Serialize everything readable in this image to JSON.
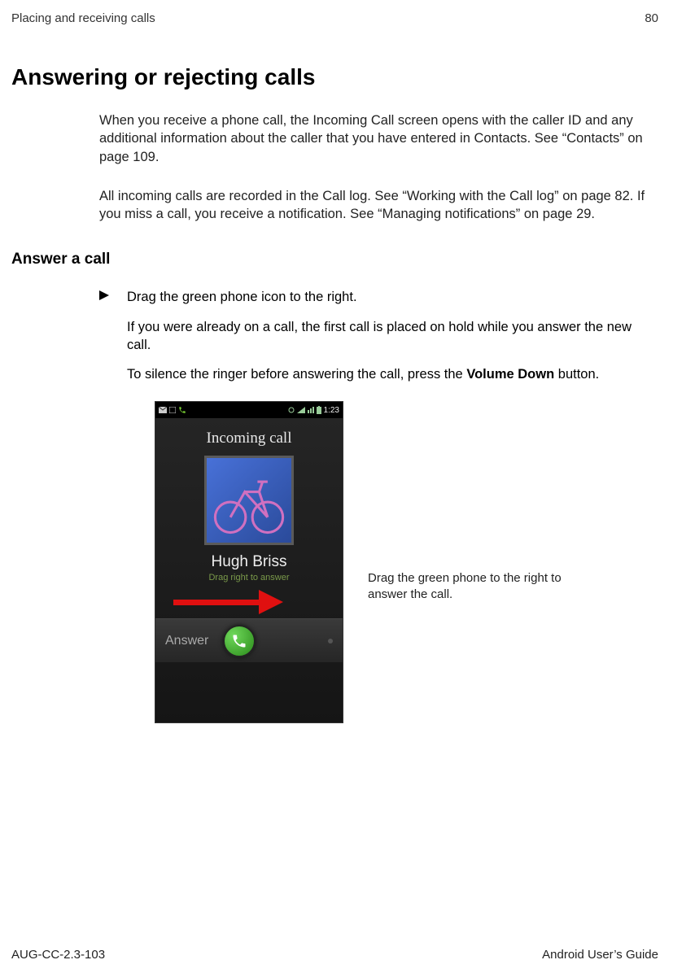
{
  "header": {
    "chapter": "Placing and receiving calls",
    "page_number": "80"
  },
  "title": "Answering or rejecting calls",
  "intro": [
    "When you receive a phone call, the Incoming Call screen opens with the caller ID and any additional information about the caller that you have entered in Contacts. See “Contacts” on page 109.",
    "All incoming calls are recorded in the Call log. See “Working with the Call log” on page 82. If you miss a call, you receive a notification. See “Managing notifications” on page 29."
  ],
  "section_heading": "Answer a call",
  "step_lead": "Drag the green phone icon to the right.",
  "step_paras": [
    "If you were already on a call, the first call is placed on hold while you answer the new call.",
    "To silence the ringer before answering the call, press the "
  ],
  "volume_button_label": "Volume Down",
  "step_para2_tail": " button.",
  "figure": {
    "status_time": "1:23",
    "incoming_label": "Incoming call",
    "caller_name": "Hugh Briss",
    "drag_hint": "Drag right to answer",
    "slider_label": "Answer"
  },
  "caption": "Drag the green phone to the right to answer the call.",
  "footer": {
    "doc_id": "AUG-CC-2.3-103",
    "guide": "Android User’s Guide"
  }
}
